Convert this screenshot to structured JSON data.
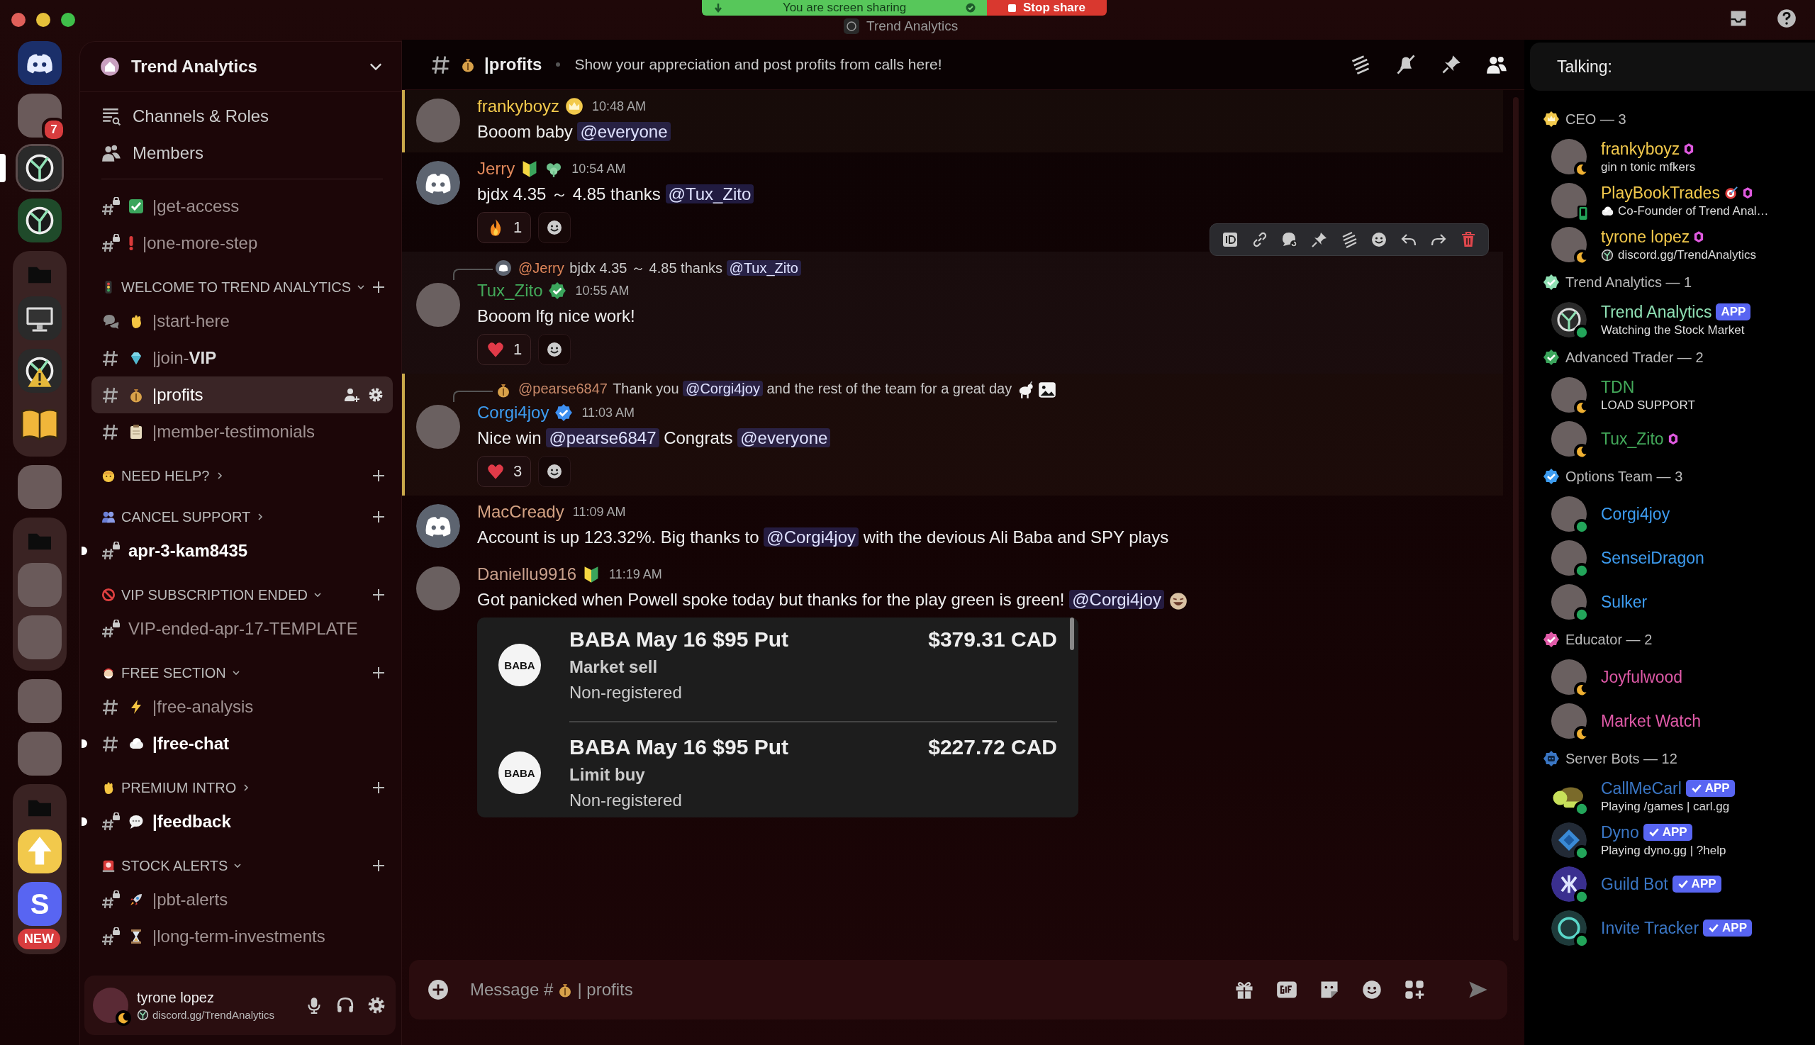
{
  "top_bar": {
    "share_status": "You are screen sharing",
    "stop_button": "Stop share",
    "title": "Trend Analytics"
  },
  "servers": [
    {
      "kind": "discord",
      "selected": false
    },
    {
      "kind": "photo",
      "selected": false,
      "badge": "7"
    },
    {
      "kind": "logo",
      "selected": true
    },
    {
      "kind": "logo-green",
      "selected": false
    },
    {
      "kind": "folder",
      "selected": false,
      "children": [
        {
          "kind": "monitor",
          "selected": false
        },
        {
          "kind": "warning-logo",
          "selected": false
        },
        {
          "kind": "book",
          "selected": false
        }
      ]
    },
    {
      "kind": "photo",
      "selected": false
    },
    {
      "kind": "folder",
      "selected": false,
      "children": [
        {
          "kind": "photo",
          "selected": false
        },
        {
          "kind": "photo",
          "selected": false
        }
      ]
    },
    {
      "kind": "photo",
      "selected": false
    },
    {
      "kind": "photo",
      "selected": false
    },
    {
      "kind": "folder",
      "selected": false,
      "children": [
        {
          "kind": "arrow",
          "selected": false
        },
        {
          "kind": "letter",
          "selected": false,
          "letter": "S",
          "label": "NEW"
        }
      ]
    }
  ],
  "server": {
    "name": "Trend Analytics"
  },
  "nav": [
    {
      "kind": "channels",
      "label": "Channels & Roles"
    },
    {
      "kind": "members",
      "label": "Members"
    }
  ],
  "channel_groups": [
    {
      "channels": [
        {
          "name": "|get-access",
          "icon": {
            "kind": "check"
          },
          "locked": true,
          "selected": false,
          "unread": false,
          "kind": "text"
        },
        {
          "name": "|one-more-step",
          "icon": {
            "kind": "exclaim"
          },
          "locked": true,
          "selected": false,
          "unread": false,
          "kind": "text"
        }
      ]
    },
    {
      "category": "WELCOME TO TREND ANALYTICS",
      "icon": {
        "kind": "traffic"
      },
      "expanded": true,
      "channels": [
        {
          "name": "|start-here",
          "icon": {
            "kind": "hand"
          },
          "selected": false,
          "unread": false,
          "kind": "forum"
        },
        {
          "name": "|join-**VIP**",
          "icon": {
            "kind": "gem"
          },
          "locked": false,
          "selected": false,
          "unread": false,
          "kind": "text"
        },
        {
          "name": "|profits",
          "icon": {
            "kind": "bag"
          },
          "locked": false,
          "selected": true,
          "unread": false,
          "kind": "text"
        },
        {
          "name": "|member-testimonials",
          "icon": {
            "kind": "clipboard"
          },
          "locked": false,
          "selected": false,
          "unread": false,
          "kind": "text"
        }
      ]
    },
    {
      "category": "NEED HELP?",
      "icon": {
        "kind": "face"
      },
      "expanded": false
    },
    {
      "category": "CANCEL SUPPORT",
      "icon": {
        "kind": "people"
      },
      "expanded": false,
      "channels": [
        {
          "name": "apr-3-kam8435",
          "locked": true,
          "selected": false,
          "unread": true,
          "kind": "text"
        }
      ]
    },
    {
      "category": "VIP SUBSCRIPTION ENDED",
      "icon": {
        "kind": "prohibited"
      },
      "expanded": true,
      "channels": [
        {
          "name": "VIP-ended-apr-17-TEMPLATE",
          "locked": true,
          "selected": false,
          "unread": false,
          "kind": "text"
        }
      ]
    },
    {
      "category": "FREE SECTION",
      "icon": {
        "kind": "santa"
      },
      "expanded": true,
      "channels": [
        {
          "name": "|free-analysis",
          "icon": {
            "kind": "bolt"
          },
          "locked": false,
          "selected": false,
          "unread": false,
          "kind": "text"
        },
        {
          "name": "|free-chat",
          "icon": {
            "kind": "cloud"
          },
          "locked": false,
          "selected": false,
          "unread": true,
          "kind": "text"
        }
      ]
    },
    {
      "category": "PREMIUM INTRO",
      "icon": {
        "kind": "hand"
      },
      "expanded": false,
      "channels": [
        {
          "name": "|feedback",
          "icon": {
            "kind": "speech"
          },
          "locked": true,
          "selected": false,
          "unread": true,
          "kind": "text"
        }
      ]
    },
    {
      "category": "STOCK ALERTS",
      "icon": {
        "kind": "siren"
      },
      "expanded": true,
      "channels": [
        {
          "name": "|pbt-alerts",
          "icon": {
            "kind": "rocket"
          },
          "locked": true,
          "selected": false,
          "unread": false,
          "kind": "text"
        },
        {
          "name": "|long-term-investments",
          "icon": {
            "kind": "hourglass"
          },
          "locked": true,
          "selected": false,
          "unread": false,
          "kind": "text"
        }
      ]
    }
  ],
  "user_panel": {
    "name": "tyrone lopez",
    "status": "discord.gg/TrendAnalytics",
    "presence": {
      "kind": "idle"
    }
  },
  "channel_header": {
    "icon": {
      "kind": "bag"
    },
    "name": "|profits",
    "topic": "Show your appreciation and post profits from calls here!"
  },
  "messages": [
    {
      "author": "frankyboyz",
      "color": "#f2c94c",
      "avatar": {
        "kind": "photo"
      },
      "badges": [
        {
          "kind": "crown"
        }
      ],
      "time": "10:48 AM",
      "highlighted": true,
      "hovered": false,
      "content": [
        {
          "kind": "text",
          "text": "Booom baby"
        },
        {
          "kind": "mention",
          "text": "@everyone"
        }
      ]
    },
    {
      "author": "Jerry",
      "color": "#e0875a",
      "avatar": {
        "kind": "discord"
      },
      "badges": [
        {
          "kind": "beginner"
        },
        {
          "kind": "leaf"
        }
      ],
      "time": "10:54 AM",
      "highlighted": false,
      "hovered": false,
      "content": [
        {
          "kind": "text",
          "text": "bjdx 4.35 ～ 4.85 thanks"
        },
        {
          "kind": "mention",
          "text": "@Tux_Zito"
        }
      ],
      "reactions": [
        {
          "icon": {
            "kind": "fire"
          },
          "count": "1"
        }
      ]
    },
    {
      "author": "Tux_Zito",
      "color": "#43a95a",
      "avatar": {
        "kind": "photo"
      },
      "badges": [
        {
          "kind": "verified-green"
        }
      ],
      "time": "10:55 AM",
      "highlighted": false,
      "hovered": true,
      "reply": {
        "avatar": {
          "kind": "discord"
        },
        "author": "@Jerry",
        "color": "#e0875a",
        "content": [
          {
            "kind": "text",
            "text": "bjdx 4.35 ～ 4.85 thanks"
          },
          {
            "kind": "mention",
            "text": "@Tux_Zito"
          }
        ]
      },
      "content": [
        {
          "kind": "text",
          "text": "Booom lfg nice work!"
        }
      ],
      "reactions": [
        {
          "icon": {
            "kind": "heart"
          },
          "count": "1"
        }
      ]
    },
    {
      "author": "Corgi4joy",
      "color": "#3d9cf0",
      "avatar": {
        "kind": "photo"
      },
      "badges": [
        {
          "kind": "verified-blue"
        }
      ],
      "time": "11:03 AM",
      "highlighted": true,
      "hovered": false,
      "reply": {
        "avatar": {
          "kind": "bag"
        },
        "author": "@pearse6847",
        "color": "#c98a6a",
        "content": [
          {
            "kind": "text",
            "text": "Thank you"
          },
          {
            "kind": "mention",
            "text": "@Corgi4joy"
          },
          {
            "kind": "text",
            "text": "and the rest of the team for a great day"
          },
          {
            "kind": "emoji",
            "icon": {
              "kind": "goat"
            }
          },
          {
            "kind": "emoji",
            "icon": {
              "kind": "image"
            }
          }
        ]
      },
      "content": [
        {
          "kind": "text",
          "text": "Nice win"
        },
        {
          "kind": "mention",
          "text": "@pearse6847"
        },
        {
          "kind": "text",
          "text": "Congrats"
        },
        {
          "kind": "mention",
          "text": "@everyone"
        }
      ],
      "reactions": [
        {
          "icon": {
            "kind": "heart"
          },
          "count": "3"
        }
      ]
    },
    {
      "author": "MacCready",
      "color": "#d4a283",
      "avatar": {
        "kind": "discord"
      },
      "time": "11:09 AM",
      "highlighted": false,
      "hovered": false,
      "content": [
        {
          "kind": "text",
          "text": "Account is up 123.32%. Big thanks to"
        },
        {
          "kind": "mention",
          "text": "@Corgi4joy"
        },
        {
          "kind": "text",
          "text": "with the devious Ali Baba and SPY plays"
        }
      ]
    },
    {
      "author": "Daniellu9916",
      "color": "#c9a08c",
      "avatar": {
        "kind": "photo"
      },
      "badges": [
        {
          "kind": "beginner"
        }
      ],
      "time": "11:19 AM",
      "highlighted": false,
      "hovered": false,
      "content": [
        {
          "kind": "text",
          "text": "Got panicked when Powell spoke today but thanks for the play green is green!"
        },
        {
          "kind": "mention",
          "text": "@Corgi4joy"
        },
        {
          "kind": "emoji",
          "icon": {
            "kind": "laugh"
          }
        }
      ],
      "attachment": {
        "rows": [
          {
            "logo": "BABA",
            "title": "BABA May 16 $95 Put",
            "amount": "$379.31 CAD",
            "order": "Market sell",
            "account": "Non-registered"
          },
          {
            "logo": "BABA",
            "title": "BABA May 16 $95 Put",
            "amount": "$227.72 CAD",
            "order": "Limit buy",
            "account": "Non-registered"
          }
        ]
      }
    }
  ],
  "composer": {
    "placeholder_start": "Message #",
    "placeholder_icon": {
      "kind": "bag"
    },
    "placeholder_end": "| profits"
  },
  "talking": {
    "label": "Talking:"
  },
  "member_groups": [
    {
      "role": "CEO — 3",
      "kind": "crown",
      "color": "#f2c94c",
      "members": [
        {
          "name": "frankyboyz",
          "color": "#f2c94c",
          "status": "gin n tonic mfkers",
          "presence": {
            "kind": "idle"
          },
          "boost": true
        },
        {
          "name": "PlayBookTrades",
          "color": "#f2c94c",
          "status_icon": {
            "kind": "cloud"
          },
          "status": "Co-Founder of Trend Anal…",
          "presence": {
            "kind": "mobile"
          },
          "boost": true,
          "name_icon": {
            "kind": "target"
          }
        },
        {
          "name": "tyrone lopez",
          "color": "#f2c94c",
          "status_icon": {
            "kind": "logo"
          },
          "status": "discord.gg/TrendAnalytics",
          "presence": {
            "kind": "idle"
          },
          "boost": true
        }
      ]
    },
    {
      "role": "Trend Analytics — 1",
      "kind": "verified",
      "color": "#8fe0b4",
      "members": [
        {
          "name": "Trend Analytics",
          "color": "#8fe0b4",
          "status": "Watching the Stock Market",
          "presence": {
            "kind": "online"
          },
          "app": "APP",
          "app_verified": false,
          "avatar": {
            "kind": "logo"
          }
        }
      ]
    },
    {
      "role": "Advanced Trader — 2",
      "kind": "verified",
      "color": "#3ba55c",
      "members": [
        {
          "name": "TDN",
          "color": "#43a95a",
          "status": "LOAD SUPPORT",
          "presence": {
            "kind": "idle"
          }
        },
        {
          "name": "Tux_Zito",
          "color": "#43a95a",
          "presence": {
            "kind": "idle"
          },
          "boost": true
        }
      ]
    },
    {
      "role": "Options Team — 3",
      "kind": "verified",
      "color": "#3d9cf0",
      "members": [
        {
          "name": "Corgi4joy",
          "color": "#3d9cf0",
          "presence": {
            "kind": "online"
          }
        },
        {
          "name": "SenseiDragon",
          "color": "#3d9cf0",
          "presence": {
            "kind": "online"
          }
        },
        {
          "name": "Sulker",
          "color": "#3d9cf0",
          "presence": {
            "kind": "online"
          }
        }
      ]
    },
    {
      "role": "Educator — 2",
      "kind": "verified",
      "color": "#e05aa8",
      "members": [
        {
          "name": "Joyfulwood",
          "color": "#e05aa8",
          "presence": {
            "kind": "idle"
          }
        },
        {
          "name": "Market Watch",
          "color": "#e05aa8",
          "presence": {
            "kind": "idle"
          }
        }
      ]
    },
    {
      "role": "Server Bots — 12",
      "kind": "robot",
      "color": "#3a76c4",
      "members": [
        {
          "name": "CallMeCarl",
          "color": "#3a76c4",
          "status": "Playing /games | carl.gg",
          "presence": {
            "kind": "online"
          },
          "app": "APP",
          "app_verified": true,
          "avatar": {
            "kind": "turtle"
          }
        },
        {
          "name": "Dyno",
          "color": "#3a76c4",
          "status": "Playing dyno.gg | ?help",
          "presence": {
            "kind": "online"
          },
          "app": "APP",
          "app_verified": true,
          "avatar": {
            "kind": "dyno"
          }
        },
        {
          "name": "Guild Bot",
          "color": "#3a76c4",
          "presence": {
            "kind": "online"
          },
          "app": "APP",
          "app_verified": true,
          "avatar": {
            "kind": "guild"
          }
        },
        {
          "name": "Invite Tracker",
          "color": "#3a76c4",
          "presence": {
            "kind": "online"
          },
          "app": "APP",
          "app_verified": true,
          "avatar": {
            "kind": "invite"
          }
        }
      ]
    }
  ]
}
